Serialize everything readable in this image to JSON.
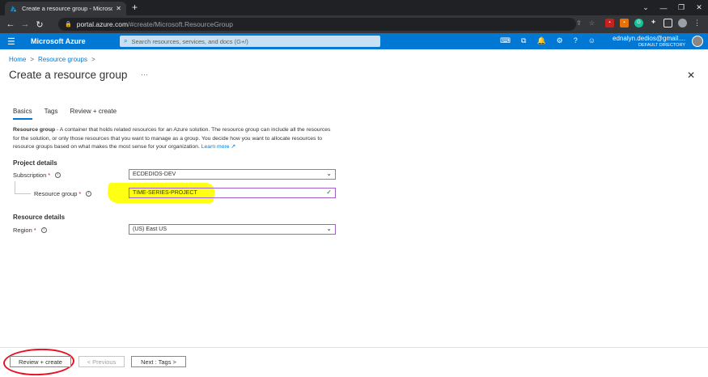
{
  "browser": {
    "tab_title": "Create a resource group - Microsoft Azure",
    "tab_close": "✕",
    "new_tab": "+",
    "url_host": "portal.azure.com",
    "url_path": "/#create/Microsoft.ResourceGroup",
    "window_controls": [
      "⌄",
      "—",
      "❐",
      "✕"
    ]
  },
  "azure": {
    "brand": "Microsoft Azure",
    "search_placeholder": "Search resources, services, and docs (G+/)",
    "user_name": "ednalyn.dedios@gmail....",
    "user_directory": "DEFAULT DIRECTORY"
  },
  "breadcrumb": {
    "home": "Home",
    "sep": ">",
    "resource_groups": "Resource groups"
  },
  "page": {
    "title": "Create a resource group",
    "more": "···",
    "close": "✕"
  },
  "tabs": [
    "Basics",
    "Tags",
    "Review + create"
  ],
  "description": {
    "lead": "Resource group",
    "body": " - A container that holds related resources for an Azure solution. The resource group can include all the resources for the solution, or only those resources that you want to manage as a group. You decide how you want to allocate resources to resource groups based on what makes the most sense for your organization. ",
    "link": "Learn more"
  },
  "project_details": {
    "heading": "Project details",
    "subscription_label": "Subscription",
    "subscription_value": "ECDEDIOS-DEV",
    "resource_group_label": "Resource group",
    "resource_group_value": "TIME-SERIES-PROJECT",
    "required_marker": "*",
    "info_marker": "i"
  },
  "resource_details": {
    "heading": "Resource details",
    "region_label": "Region",
    "region_value": "(US) East US"
  },
  "footer": {
    "review_create": "Review + create",
    "previous": "< Previous",
    "next": "Next : Tags >"
  }
}
